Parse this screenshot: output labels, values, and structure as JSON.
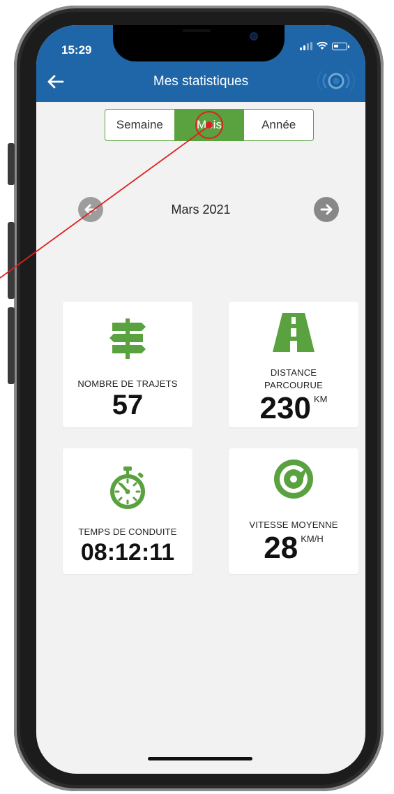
{
  "status_bar": {
    "time": "15:29"
  },
  "header": {
    "title": "Mes statistiques"
  },
  "tabs": [
    {
      "label": "Semaine",
      "active": false
    },
    {
      "label": "Mois",
      "active": true
    },
    {
      "label": "Année",
      "active": false
    }
  ],
  "period": {
    "label": "Mars 2021"
  },
  "stats": {
    "trips": {
      "label": "NOMBRE DE TRAJETS",
      "value": "57",
      "icon": "signpost-icon"
    },
    "distance": {
      "label_line1": "DISTANCE",
      "label_line2": "PARCOURUE",
      "value": "230",
      "unit": "KM",
      "icon": "road-icon"
    },
    "driving_time": {
      "label": "TEMPS DE CONDUITE",
      "value": "08:12:11",
      "icon": "stopwatch-icon"
    },
    "avg_speed": {
      "label": "VITESSE MOYENNE",
      "value": "28",
      "unit": "KM/H",
      "icon": "speedometer-icon"
    }
  },
  "colors": {
    "header_blue": "#1f66a8",
    "accent_green": "#5aa13f",
    "background": "#f2f2f2",
    "click_marker": "#e02020"
  }
}
